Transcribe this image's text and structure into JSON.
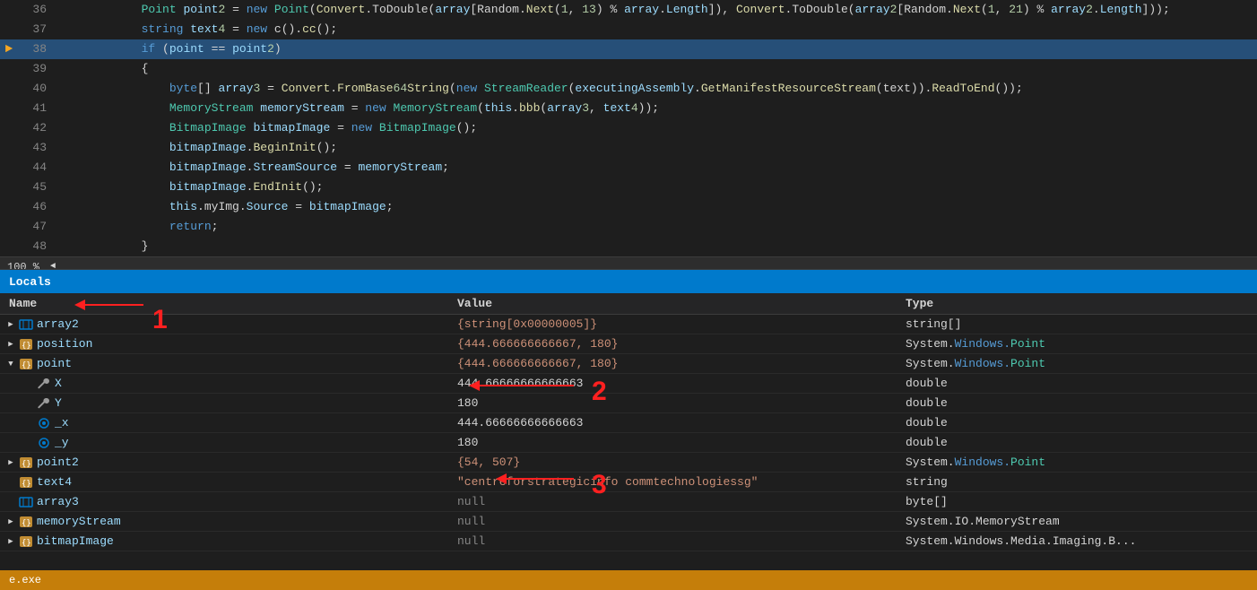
{
  "editor": {
    "lines": [
      {
        "num": "36",
        "arrow": false,
        "highlighted": false,
        "content": "            Point point2 = new Point(Convert.ToDouble(array[Random.Next(1, 13) % array.Length]), Convert.ToDouble(array2[Random.Next(1, 21) % array2.Length]));"
      },
      {
        "num": "37",
        "arrow": false,
        "highlighted": false,
        "content": "            string text4 = new c().cc();"
      },
      {
        "num": "38",
        "arrow": true,
        "highlighted": true,
        "content": "            if (point == point2)"
      },
      {
        "num": "39",
        "arrow": false,
        "highlighted": false,
        "content": "            {"
      },
      {
        "num": "40",
        "arrow": false,
        "highlighted": false,
        "content": "                byte[] array3 = Convert.FromBase64String(new StreamReader(executingAssembly.GetManifestResourceStream(text)).ReadToEnd());"
      },
      {
        "num": "41",
        "arrow": false,
        "highlighted": false,
        "content": "                MemoryStream memoryStream = new MemoryStream(this.bbb(array3, text4));"
      },
      {
        "num": "42",
        "arrow": false,
        "highlighted": false,
        "content": "                BitmapImage bitmapImage = new BitmapImage();"
      },
      {
        "num": "43",
        "arrow": false,
        "highlighted": false,
        "content": "                bitmapImage.BeginInit();"
      },
      {
        "num": "44",
        "arrow": false,
        "highlighted": false,
        "content": "                bitmapImage.StreamSource = memoryStream;"
      },
      {
        "num": "45",
        "arrow": false,
        "highlighted": false,
        "content": "                bitmapImage.EndInit();"
      },
      {
        "num": "46",
        "arrow": false,
        "highlighted": false,
        "content": "                this.myImg.Source = bitmapImage;"
      },
      {
        "num": "47",
        "arrow": false,
        "highlighted": false,
        "content": "                return;"
      },
      {
        "num": "48",
        "arrow": false,
        "highlighted": false,
        "content": "            }"
      }
    ],
    "zoom": "100 %"
  },
  "locals": {
    "header": "Locals",
    "columns": {
      "name": "Name",
      "value": "Value",
      "type": "Type"
    },
    "rows": [
      {
        "id": "array2",
        "indent": 0,
        "expandable": true,
        "expanded": false,
        "icon": "array",
        "name": "array2",
        "value": "{string[0x00000005]}",
        "value_color": "orange",
        "type": "string[]",
        "type_color": "plain"
      },
      {
        "id": "position",
        "indent": 0,
        "expandable": true,
        "expanded": false,
        "icon": "object",
        "name": "position",
        "value": "{444.666666666667, 180}",
        "value_color": "orange",
        "type_prefix": "System.",
        "type_windows": "Windows.",
        "type_suffix": "Point",
        "type_color": "mixed"
      },
      {
        "id": "point",
        "indent": 0,
        "expandable": true,
        "expanded": true,
        "icon": "object",
        "name": "point",
        "value": "{444.666666666667, 180}",
        "value_color": "orange",
        "type_prefix": "System.",
        "type_windows": "Windows.",
        "type_suffix": "Point",
        "type_color": "mixed"
      },
      {
        "id": "X",
        "indent": 1,
        "expandable": false,
        "expanded": false,
        "icon": "wrench",
        "name": "X",
        "value": "444.66666666666663",
        "value_color": "white",
        "type": "double",
        "type_color": "plain"
      },
      {
        "id": "Y",
        "indent": 1,
        "expandable": false,
        "expanded": false,
        "icon": "wrench",
        "name": "Y",
        "value": "180",
        "value_color": "white",
        "type": "double",
        "type_color": "plain"
      },
      {
        "id": "_x",
        "indent": 1,
        "expandable": false,
        "expanded": false,
        "icon": "field",
        "name": "_x",
        "value": "444.66666666666663",
        "value_color": "white",
        "type": "double",
        "type_color": "plain"
      },
      {
        "id": "_y",
        "indent": 1,
        "expandable": false,
        "expanded": false,
        "icon": "field",
        "name": "_y",
        "value": "180",
        "value_color": "white",
        "type": "double",
        "type_color": "plain"
      },
      {
        "id": "point2",
        "indent": 0,
        "expandable": true,
        "expanded": false,
        "icon": "object",
        "name": "point2",
        "value": "{54, 507}",
        "value_color": "orange",
        "type_prefix": "System.",
        "type_windows": "Windows.",
        "type_suffix": "Point",
        "type_color": "mixed"
      },
      {
        "id": "text4",
        "indent": 0,
        "expandable": false,
        "expanded": false,
        "icon": "object",
        "name": "text4",
        "value": "\"centreforstrategicinfo commtechnologiessg\"",
        "value_color": "string",
        "type": "string",
        "type_color": "plain"
      },
      {
        "id": "array3",
        "indent": 0,
        "expandable": false,
        "expanded": false,
        "icon": "array",
        "name": "array3",
        "value": "null",
        "value_color": "gray",
        "type": "byte[]",
        "type_color": "plain"
      },
      {
        "id": "memoryStream",
        "indent": 0,
        "expandable": true,
        "expanded": false,
        "icon": "object",
        "name": "memoryStream",
        "value": "null",
        "value_color": "gray",
        "type": "System.IO.MemoryStream",
        "type_color": "plain"
      },
      {
        "id": "bitmapImage",
        "indent": 0,
        "expandable": true,
        "expanded": false,
        "icon": "object",
        "name": "bitmapImage",
        "value": "null",
        "value_color": "gray",
        "type": "System.Windows.Media.Imaging.B...",
        "type_color": "plain"
      }
    ]
  },
  "status_bar": {
    "text": "e.exe"
  },
  "annotations": {
    "arrow1_label": "1",
    "arrow2_label": "2",
    "arrow3_label": "3"
  }
}
